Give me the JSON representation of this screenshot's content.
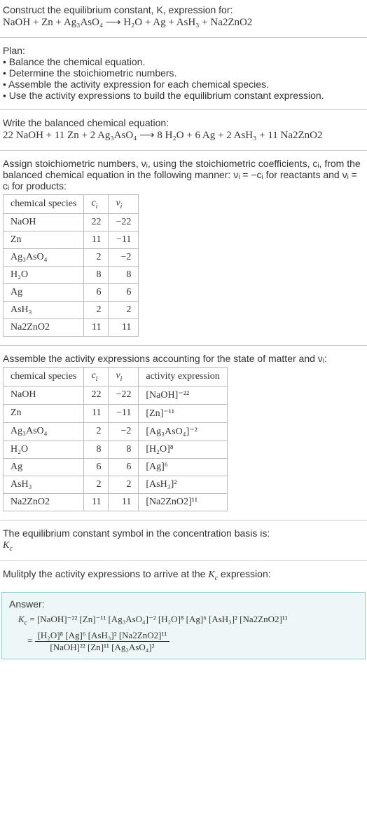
{
  "intro": {
    "line1": "Construct the equilibrium constant, K, expression for:",
    "reaction_unbalanced": "NaOH + Zn + Ag₃AsO₄  ⟶  H₂O + Ag + AsH₃ + Na2ZnO2"
  },
  "plan": {
    "heading": "Plan:",
    "b1": "• Balance the chemical equation.",
    "b2": "• Determine the stoichiometric numbers.",
    "b3": "• Assemble the activity expression for each chemical species.",
    "b4": "• Use the activity expressions to build the equilibrium constant expression."
  },
  "balanced": {
    "heading": "Write the balanced chemical equation:",
    "reaction": "22 NaOH + 11 Zn + 2 Ag₃AsO₄  ⟶  8 H₂O + 6 Ag + 2 AsH₃ + 11 Na2ZnO2"
  },
  "stoich_intro": "Assign stoichiometric numbers, νᵢ, using the stoichiometric coefficients, cᵢ, from the balanced chemical equation in the following manner: νᵢ = −cᵢ for reactants and νᵢ = cᵢ for products:",
  "table1": {
    "h1": "chemical species",
    "h2": "cᵢ",
    "h3": "νᵢ",
    "rows": [
      {
        "s": "NaOH",
        "c": "22",
        "v": "−22"
      },
      {
        "s": "Zn",
        "c": "11",
        "v": "−11"
      },
      {
        "s": "Ag₃AsO₄",
        "c": "2",
        "v": "−2"
      },
      {
        "s": "H₂O",
        "c": "8",
        "v": "8"
      },
      {
        "s": "Ag",
        "c": "6",
        "v": "6"
      },
      {
        "s": "AsH₃",
        "c": "2",
        "v": "2"
      },
      {
        "s": "Na2ZnO2",
        "c": "11",
        "v": "11"
      }
    ]
  },
  "activity_intro": "Assemble the activity expressions accounting for the state of matter and νᵢ:",
  "table2": {
    "h1": "chemical species",
    "h2": "cᵢ",
    "h3": "νᵢ",
    "h4": "activity expression",
    "rows": [
      {
        "s": "NaOH",
        "c": "22",
        "v": "−22",
        "a": "[NaOH]⁻²²"
      },
      {
        "s": "Zn",
        "c": "11",
        "v": "−11",
        "a": "[Zn]⁻¹¹"
      },
      {
        "s": "Ag₃AsO₄",
        "c": "2",
        "v": "−2",
        "a": "[Ag₃AsO₄]⁻²"
      },
      {
        "s": "H₂O",
        "c": "8",
        "v": "8",
        "a": "[H₂O]⁸"
      },
      {
        "s": "Ag",
        "c": "6",
        "v": "6",
        "a": "[Ag]⁶"
      },
      {
        "s": "AsH₃",
        "c": "2",
        "v": "2",
        "a": "[AsH₃]²"
      },
      {
        "s": "Na2ZnO2",
        "c": "11",
        "v": "11",
        "a": "[Na2ZnO2]¹¹"
      }
    ]
  },
  "kc_intro": {
    "line1": "The equilibrium constant symbol in the concentration basis is:",
    "symbol": "K_c"
  },
  "multiply": "Mulitply the activity expressions to arrive at the K_c expression:",
  "answer": {
    "label": "Answer:",
    "lhs": "K_c = ",
    "line1": "[NaOH]⁻²² [Zn]⁻¹¹ [Ag₃AsO₄]⁻² [H₂O]⁸ [Ag]⁶ [AsH₃]² [Na2ZnO2]¹¹",
    "eq": " = ",
    "num": "[H₂O]⁸ [Ag]⁶ [AsH₃]² [Na2ZnO2]¹¹",
    "den": "[NaOH]²² [Zn]¹¹ [Ag₃AsO₄]²"
  }
}
